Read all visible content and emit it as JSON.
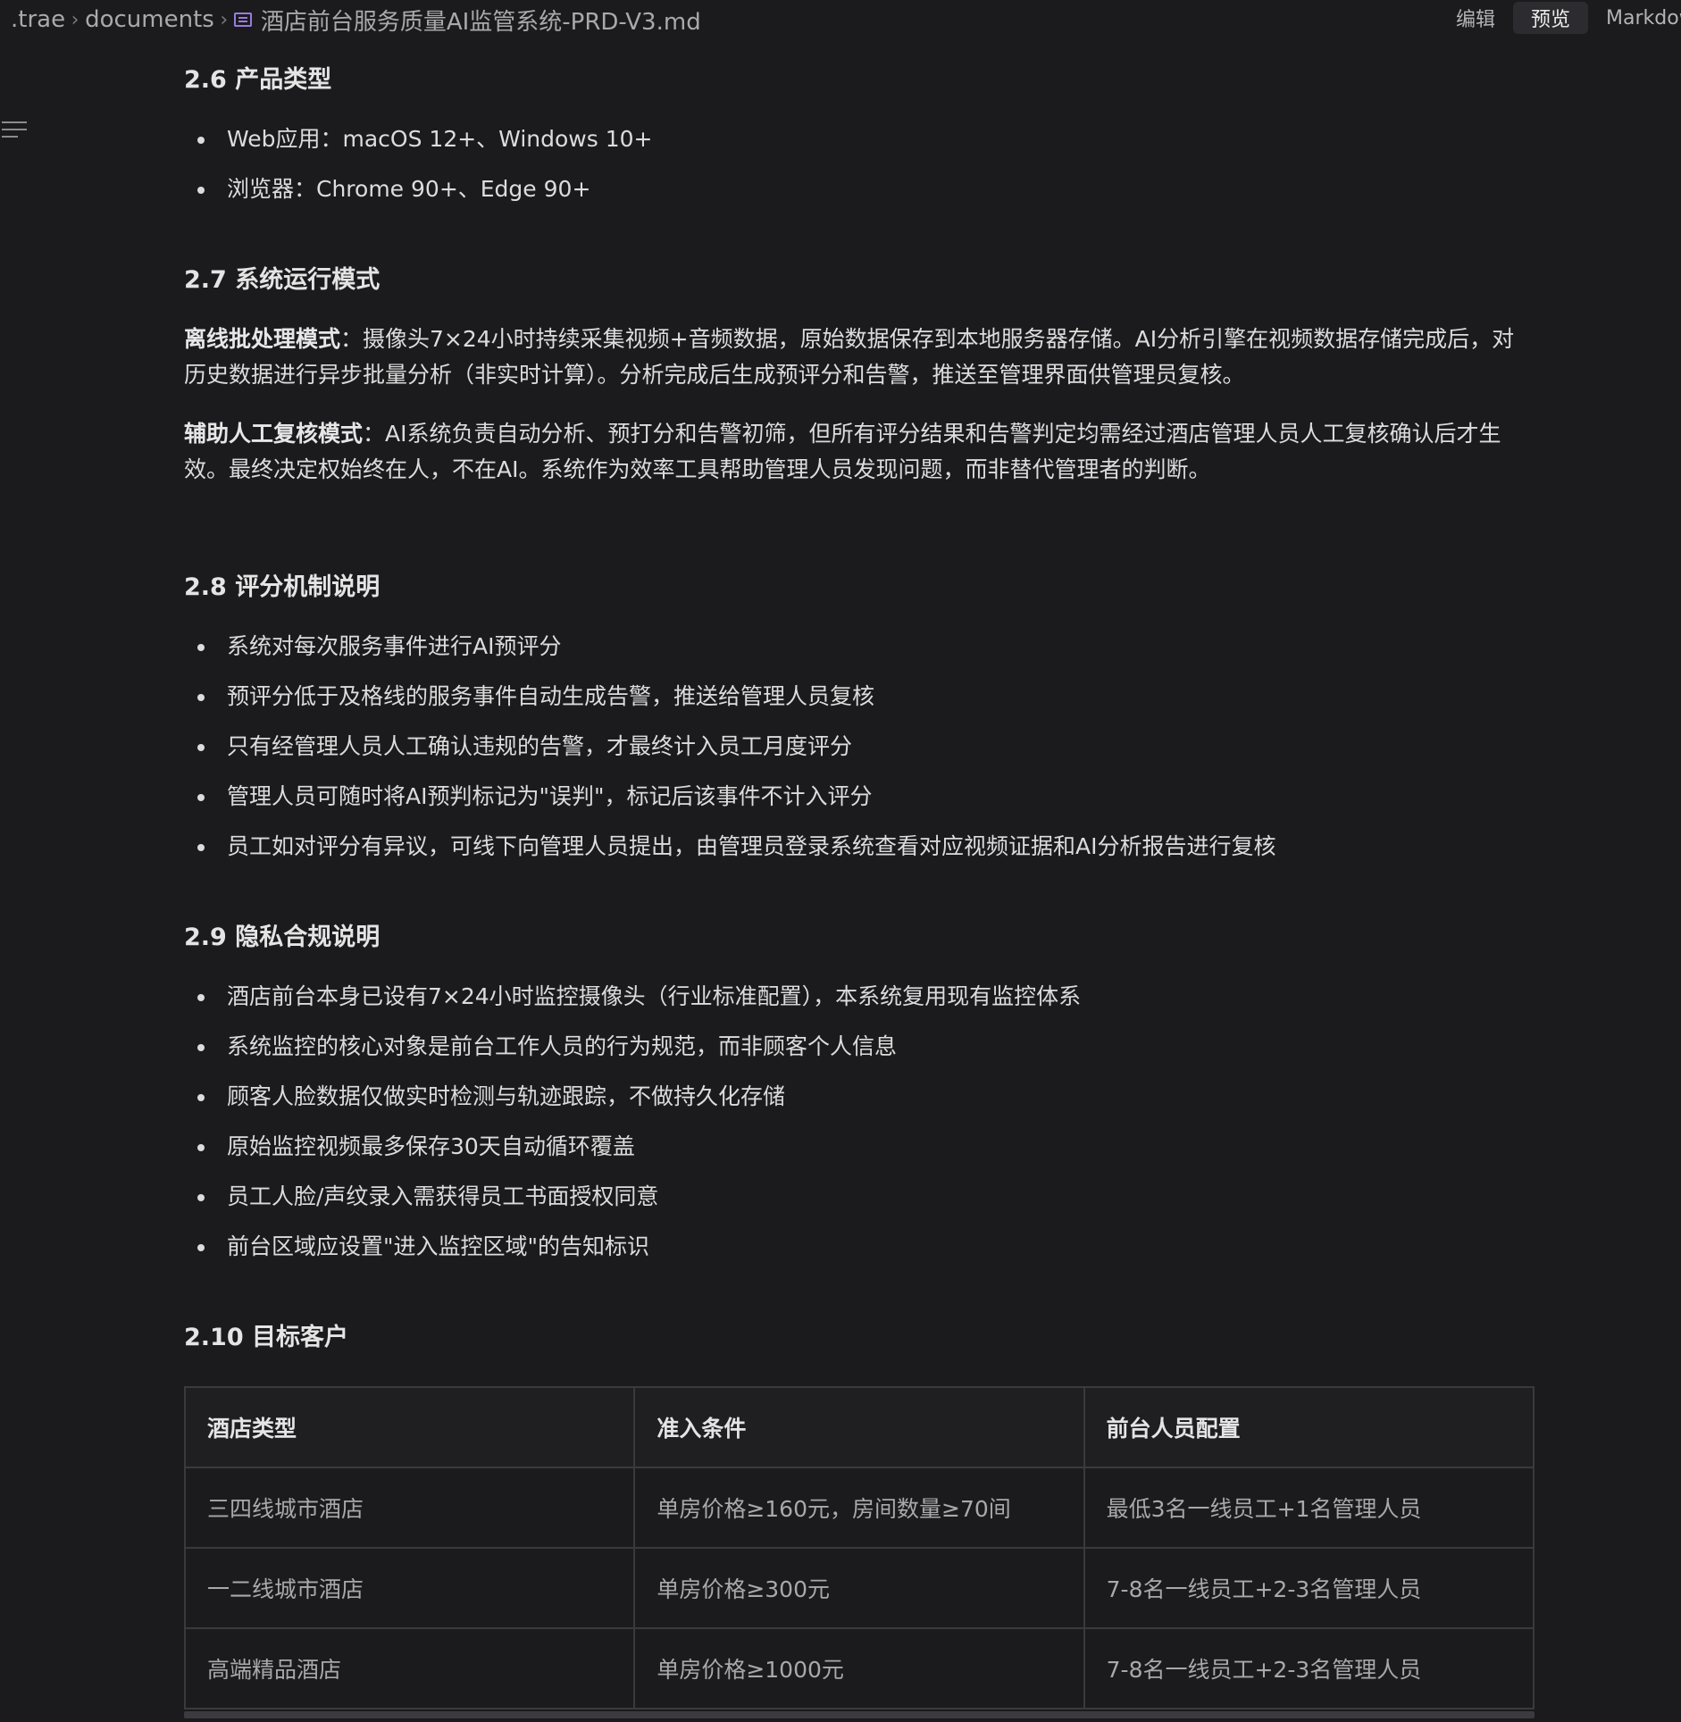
{
  "breadcrumb": {
    "root": ".trae",
    "folder": "documents",
    "file": "酒店前台服务质量AI监管系统-PRD-V3.md",
    "file_icon": "markdown-file-icon",
    "separator_icon": "chevron-right-icon"
  },
  "view_switch": {
    "edit": "编辑",
    "preview": "预览",
    "markdown": "Markdown",
    "active": "预览"
  },
  "outline_icon": "outline-list-icon",
  "sections": {
    "s26": {
      "title": "2.6 产品类型",
      "items": [
        "Web应用：macOS 12+、Windows 10+",
        "浏览器：Chrome 90+、Edge 90+"
      ]
    },
    "s27": {
      "title": "2.7 系统运行模式",
      "p1_label": "离线批处理模式",
      "p1_text": "：摄像头7×24小时持续采集视频+音频数据，原始数据保存到本地服务器存储。AI分析引擎在视频数据存储完成后，对历史数据进行异步批量分析（非实时计算）。分析完成后生成预评分和告警，推送至管理界面供管理员复核。",
      "p2_label": "辅助人工复核模式",
      "p2_text": "：AI系统负责自动分析、预打分和告警初筛，但所有评分结果和告警判定均需经过酒店管理人员人工复核确认后才生效。最终决定权始终在人，不在AI。系统作为效率工具帮助管理人员发现问题，而非替代管理者的判断。"
    },
    "s28": {
      "title": "2.8 评分机制说明",
      "items": [
        "系统对每次服务事件进行AI预评分",
        "预评分低于及格线的服务事件自动生成告警，推送给管理人员复核",
        "只有经管理人员人工确认违规的告警，才最终计入员工月度评分",
        "管理人员可随时将AI预判标记为\"误判\"，标记后该事件不计入评分",
        "员工如对评分有异议，可线下向管理人员提出，由管理员登录系统查看对应视频证据和AI分析报告进行复核"
      ]
    },
    "s29": {
      "title": "2.9 隐私合规说明",
      "items": [
        "酒店前台本身已设有7×24小时监控摄像头（行业标准配置），本系统复用现有监控体系",
        "系统监控的核心对象是前台工作人员的行为规范，而非顾客个人信息",
        "顾客人脸数据仅做实时检测与轨迹跟踪，不做持久化存储",
        "原始监控视频最多保存30天自动循环覆盖",
        "员工人脸/声纹录入需获得员工书面授权同意",
        "前台区域应设置\"进入监控区域\"的告知标识"
      ]
    },
    "s210": {
      "title": "2.10 目标客户",
      "table": {
        "headers": [
          "酒店类型",
          "准入条件",
          "前台人员配置"
        ],
        "rows": [
          [
            "三四线城市酒店",
            "单房价格≥160元，房间数量≥70间",
            "最低3名一线员工+1名管理人员"
          ],
          [
            "一二线城市酒店",
            "单房价格≥300元",
            "7-8名一线员工+2-3名管理人员"
          ],
          [
            "高端精品酒店",
            "单房价格≥1000元",
            "7-8名一线员工+2-3名管理人员"
          ]
        ]
      }
    }
  }
}
